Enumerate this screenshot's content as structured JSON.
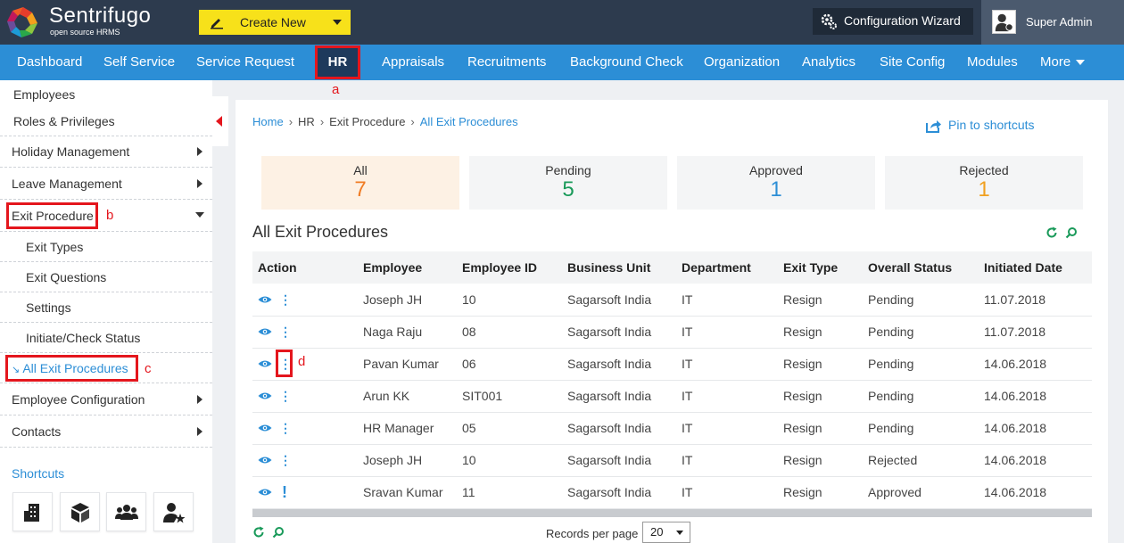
{
  "header": {
    "brand": "Sentrifugo",
    "brand_sub": "open source HRMS",
    "create_new": "Create New",
    "config_wizard": "Configuration Wizard",
    "user": "Super Admin"
  },
  "nav": {
    "items": [
      "Dashboard",
      "Self Service",
      "Service Request",
      "HR",
      "Appraisals",
      "Recruitments",
      "Background Check",
      "Organization",
      "Analytics",
      "Site Config",
      "Modules",
      "More"
    ],
    "active": "HR"
  },
  "annotations": {
    "a": "a",
    "b": "b",
    "c": "c",
    "d": "d"
  },
  "sidebar": {
    "items": [
      {
        "label": "Employees"
      },
      {
        "label": "Roles & Privileges"
      },
      {
        "label": "Holiday Management"
      },
      {
        "label": "Leave Management"
      },
      {
        "label": "Exit Procedure"
      },
      {
        "label": "Exit Types"
      },
      {
        "label": "Exit Questions"
      },
      {
        "label": "Settings"
      },
      {
        "label": "Initiate/Check Status"
      },
      {
        "label": "All Exit Procedures"
      },
      {
        "label": "Employee Configuration"
      },
      {
        "label": "Contacts"
      }
    ],
    "shortcuts_label": "Shortcuts",
    "shortcut_icons": [
      "building-icon",
      "boxes-icon",
      "users-icon",
      "user-star-icon"
    ]
  },
  "breadcrumb": [
    "Home",
    "HR",
    "Exit Procedure",
    "All Exit Procedures"
  ],
  "pin_label": "Pin to shortcuts",
  "stats": [
    {
      "label": "All",
      "value": "7",
      "color": "#f07c24"
    },
    {
      "label": "Pending",
      "value": "5",
      "color": "#1a9a5a"
    },
    {
      "label": "Approved",
      "value": "1",
      "color": "#2c8ed6"
    },
    {
      "label": "Rejected",
      "value": "1",
      "color": "#f0a020"
    }
  ],
  "section_title": "All Exit Procedures",
  "table": {
    "columns": [
      "Action",
      "Employee",
      "Employee ID",
      "Business Unit",
      "Department",
      "Exit Type",
      "Overall Status",
      "Initiated Date"
    ],
    "rows": [
      [
        "Joseph JH",
        "10",
        "Sagarsoft India",
        "IT",
        "Resign",
        "Pending",
        "11.07.2018"
      ],
      [
        "Naga Raju",
        "08",
        "Sagarsoft India",
        "IT",
        "Resign",
        "Pending",
        "11.07.2018"
      ],
      [
        "Pavan Kumar",
        "06",
        "Sagarsoft India",
        "IT",
        "Resign",
        "Pending",
        "14.06.2018"
      ],
      [
        "Arun KK",
        "SIT001",
        "Sagarsoft India",
        "IT",
        "Resign",
        "Pending",
        "14.06.2018"
      ],
      [
        "HR Manager",
        "05",
        "Sagarsoft India",
        "IT",
        "Resign",
        "Pending",
        "14.06.2018"
      ],
      [
        "Joseph JH",
        "10",
        "Sagarsoft India",
        "IT",
        "Resign",
        "Rejected",
        "14.06.2018"
      ],
      [
        "Sravan Kumar",
        "11",
        "Sagarsoft India",
        "IT",
        "Resign",
        "Approved",
        "14.06.2018"
      ]
    ]
  },
  "records_per_page_label": "Records per page",
  "records_per_page": "20",
  "colors": {
    "topbar": "#2d3b4e",
    "nav": "#2c8ed6",
    "highlight": "#e4161d",
    "create": "#f7e11a"
  }
}
